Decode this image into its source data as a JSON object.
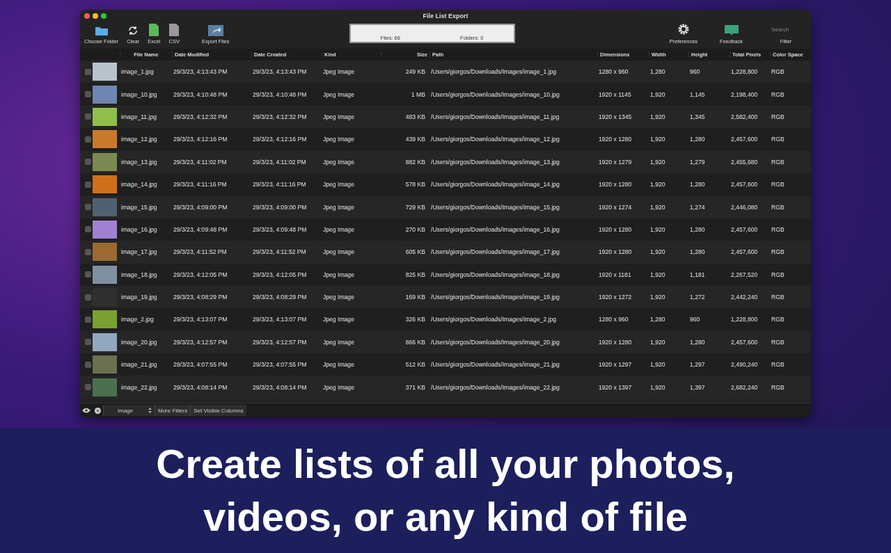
{
  "window": {
    "title": "File List Export"
  },
  "toolbar": {
    "left": [
      {
        "label": "Choose Folder",
        "kind": "folder"
      },
      {
        "label": "Clear",
        "kind": "clear"
      },
      {
        "label": "Excel",
        "kind": "excel"
      },
      {
        "label": "CSV",
        "kind": "csv"
      },
      {
        "label": "Export Files",
        "kind": "export"
      }
    ],
    "counts": {
      "files": "Files: 66",
      "folders": "Folders: 0"
    },
    "right": [
      {
        "label": "Preferences",
        "kind": "gear"
      },
      {
        "label": "Feedback",
        "kind": "feedback"
      }
    ],
    "filter": {
      "placeholder": "Search",
      "label": "Filter"
    }
  },
  "table": {
    "columns": [
      "File Name",
      "Date Modified",
      "Date Created",
      "Kind",
      "Size",
      "Path",
      "Dimensions",
      "Width",
      "Height",
      "Total Pixels",
      "Color Space"
    ],
    "rows": [
      {
        "checked": false,
        "cells": [
          "image_1.jpg",
          "29/3/23, 4:13:43 PM",
          "29/3/23, 4:13:43 PM",
          "Jpeg Image",
          "249 KB",
          "/Users/giorgos/Downloads/Images/image_1.jpg",
          "1280 x 960",
          "1,280",
          "960",
          "1,228,800",
          "RGB"
        ]
      },
      {
        "checked": false,
        "cells": [
          "image_10.jpg",
          "29/3/23, 4:10:48 PM",
          "29/3/23, 4:10:48 PM",
          "Jpeg Image",
          "1 MB",
          "/Users/giorgos/Downloads/Images/image_10.jpg",
          "1920 x 1145",
          "1,920",
          "1,145",
          "2,198,400",
          "RGB"
        ]
      },
      {
        "checked": false,
        "cells": [
          "image_11.jpg",
          "29/3/23, 4:12:32 PM",
          "29/3/23, 4:12:32 PM",
          "Jpeg Image",
          "483 KB",
          "/Users/giorgos/Downloads/Images/image_11.jpg",
          "1920 x 1345",
          "1,920",
          "1,345",
          "2,582,400",
          "RGB"
        ]
      },
      {
        "checked": false,
        "cells": [
          "image_12.jpg",
          "29/3/23, 4:12:16 PM",
          "29/3/23, 4:12:16 PM",
          "Jpeg Image",
          "439 KB",
          "/Users/giorgos/Downloads/Images/image_12.jpg",
          "1920 x 1280",
          "1,920",
          "1,280",
          "2,457,600",
          "RGB"
        ]
      },
      {
        "checked": false,
        "cells": [
          "image_13.jpg",
          "29/3/23, 4:11:02 PM",
          "29/3/23, 4:11:02 PM",
          "Jpeg Image",
          "882 KB",
          "/Users/giorgos/Downloads/Images/image_13.jpg",
          "1920 x 1279",
          "1,920",
          "1,279",
          "2,455,680",
          "RGB"
        ]
      },
      {
        "checked": false,
        "cells": [
          "image_14.jpg",
          "29/3/23, 4:11:16 PM",
          "29/3/23, 4:11:16 PM",
          "Jpeg Image",
          "578 KB",
          "/Users/giorgos/Downloads/Images/image_14.jpg",
          "1920 x 1280",
          "1,920",
          "1,280",
          "2,457,600",
          "RGB"
        ]
      },
      {
        "checked": false,
        "cells": [
          "image_15.jpg",
          "29/3/23, 4:09:00 PM",
          "29/3/23, 4:09:00 PM",
          "Jpeg Image",
          "729 KB",
          "/Users/giorgos/Downloads/Images/image_15.jpg",
          "1920 x 1274",
          "1,920",
          "1,274",
          "2,446,080",
          "RGB"
        ]
      },
      {
        "checked": false,
        "cells": [
          "image_16.jpg",
          "29/3/23, 4:09:48 PM",
          "29/3/23, 4:09:48 PM",
          "Jpeg Image",
          "270 KB",
          "/Users/giorgos/Downloads/Images/image_16.jpg",
          "1920 x 1280",
          "1,920",
          "1,280",
          "2,457,600",
          "RGB"
        ]
      },
      {
        "checked": false,
        "cells": [
          "image_17.jpg",
          "29/3/23, 4:11:52 PM",
          "29/3/23, 4:11:52 PM",
          "Jpeg Image",
          "605 KB",
          "/Users/giorgos/Downloads/Images/image_17.jpg",
          "1920 x 1280",
          "1,920",
          "1,280",
          "2,457,600",
          "RGB"
        ]
      },
      {
        "checked": false,
        "cells": [
          "image_18.jpg",
          "29/3/23, 4:12:05 PM",
          "29/3/23, 4:12:05 PM",
          "Jpeg Image",
          "825 KB",
          "/Users/giorgos/Downloads/Images/image_18.jpg",
          "1920 x 1181",
          "1,920",
          "1,181",
          "2,267,520",
          "RGB"
        ]
      },
      {
        "checked": false,
        "cells": [
          "image_19.jpg",
          "29/3/23, 4:08:29 PM",
          "29/3/23, 4:08:29 PM",
          "Jpeg Image",
          "169 KB",
          "/Users/giorgos/Downloads/Images/image_19.jpg",
          "1920 x 1272",
          "1,920",
          "1,272",
          "2,442,240",
          "RGB"
        ]
      },
      {
        "checked": false,
        "cells": [
          "image_2.jpg",
          "29/3/23, 4:13:07 PM",
          "29/3/23, 4:13:07 PM",
          "Jpeg Image",
          "326 KB",
          "/Users/giorgos/Downloads/Images/image_2.jpg",
          "1280 x 960",
          "1,280",
          "960",
          "1,228,800",
          "RGB"
        ]
      },
      {
        "checked": false,
        "cells": [
          "image_20.jpg",
          "29/3/23, 4:12:57 PM",
          "29/3/23, 4:12:57 PM",
          "Jpeg Image",
          "866 KB",
          "/Users/giorgos/Downloads/Images/image_20.jpg",
          "1920 x 1280",
          "1,920",
          "1,280",
          "2,457,600",
          "RGB"
        ]
      },
      {
        "checked": false,
        "cells": [
          "image_21.jpg",
          "29/3/23, 4:07:55 PM",
          "29/3/23, 4:07:55 PM",
          "Jpeg Image",
          "512 KB",
          "/Users/giorgos/Downloads/Images/image_21.jpg",
          "1920 x 1297",
          "1,920",
          "1,297",
          "2,490,240",
          "RGB"
        ]
      },
      {
        "checked": false,
        "cells": [
          "image_22.jpg",
          "29/3/23, 4:08:14 PM",
          "29/3/23, 4:08:14 PM",
          "Jpeg Image",
          "371 KB",
          "/Users/giorgos/Downloads/Images/image_22.jpg",
          "1920 x 1397",
          "1,920",
          "1,397",
          "2,682,240",
          "RGB"
        ]
      }
    ]
  },
  "bottom_bar": {
    "type_select": "Image",
    "buttons": [
      "More Filters",
      "Set Visible Columns"
    ]
  },
  "caption": [
    "Create lists of all your photos,",
    "videos, or any kind of file"
  ]
}
